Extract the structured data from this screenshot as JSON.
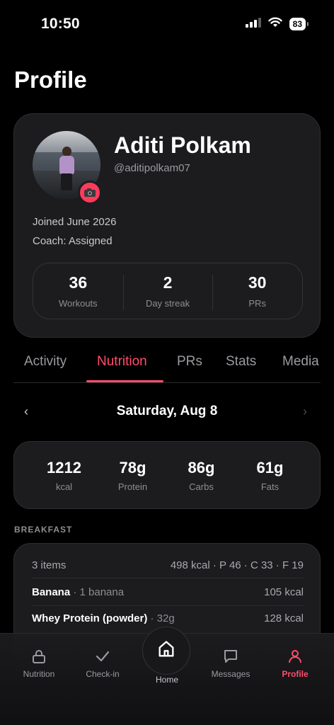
{
  "status_bar": {
    "time": "10:50",
    "battery": "83"
  },
  "page": {
    "title": "Profile"
  },
  "profile": {
    "name": "Aditi Polkam",
    "handle": "@aditipolkam07",
    "joined": "Joined June 2026",
    "coach": "Coach: Assigned",
    "stats": [
      {
        "value": "36",
        "label": "Workouts"
      },
      {
        "value": "2",
        "label": "Day streak"
      },
      {
        "value": "30",
        "label": "PRs"
      }
    ]
  },
  "tabs": [
    "Activity",
    "Nutrition",
    "PRs",
    "Stats",
    "Media"
  ],
  "active_tab": "Nutrition",
  "date_nav": {
    "prev": "‹",
    "label": "Saturday, Aug 8",
    "next": "›"
  },
  "macros": [
    {
      "value": "1212",
      "label": "kcal"
    },
    {
      "value": "78g",
      "label": "Protein"
    },
    {
      "value": "86g",
      "label": "Carbs"
    },
    {
      "value": "61g",
      "label": "Fats"
    }
  ],
  "breakfast": {
    "heading": "BREAKFAST",
    "summary_items": "3 items",
    "summary_macros": "498 kcal · P 46 · C 33 · F 19",
    "foods": [
      {
        "name": "Banana",
        "qty": " · 1 banana",
        "kcal": "105 kcal"
      },
      {
        "name": "Whey Protein (powder)",
        "qty": " · 32g",
        "kcal": "128 kcal"
      }
    ]
  },
  "bottom_nav": {
    "items": [
      {
        "label": "Nutrition",
        "icon": "lock-icon"
      },
      {
        "label": "Check-in",
        "icon": "check-icon"
      },
      {
        "label": "Home",
        "icon": "home-icon"
      },
      {
        "label": "Messages",
        "icon": "message-icon"
      },
      {
        "label": "Profile",
        "icon": "person-icon"
      }
    ],
    "active": "Profile"
  },
  "colors": {
    "accent": "#ff4d6a",
    "card": "#1c1c1e",
    "background": "#000000"
  }
}
